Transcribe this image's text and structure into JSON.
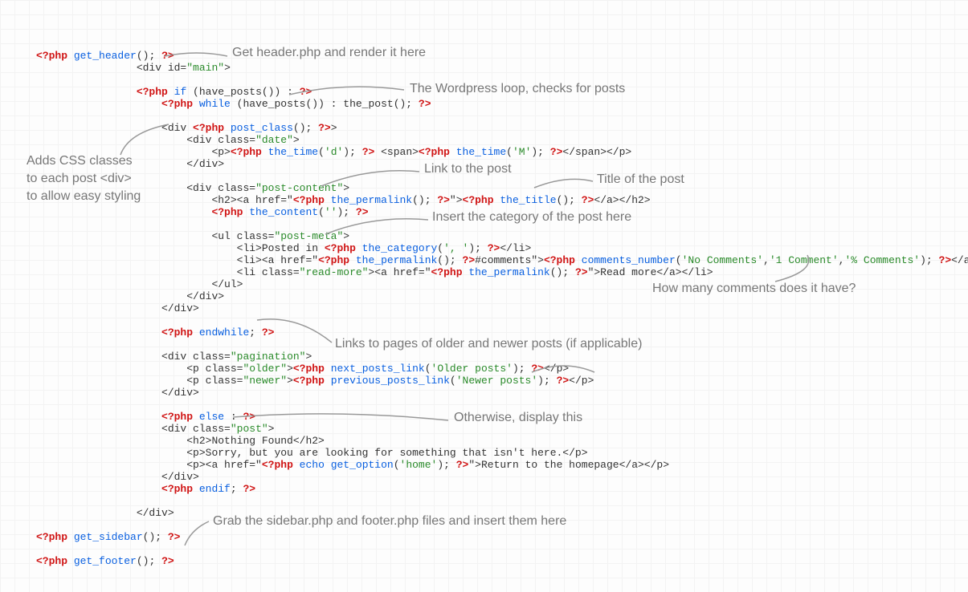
{
  "code": {
    "l1": {
      "a": "<?php",
      "b": " get_header",
      "c": "(); ",
      "d": "?>"
    },
    "l2": {
      "a": "<div id=",
      "b": "\"main\"",
      "c": ">"
    },
    "l3": {
      "a": "<?php",
      "b": " if",
      "c": " (have_posts()) : ",
      "d": "?>"
    },
    "l4": {
      "a": "<?php",
      "b": " while",
      "c": " (have_posts()) : the_post(); ",
      "d": "?>"
    },
    "l5": {
      "a": "<div ",
      "b": "<?php",
      "c": " post_class",
      "d": "(); ",
      "e": "?>",
      "f": ">"
    },
    "l6": {
      "a": "<div class=",
      "b": "\"date\"",
      "c": ">"
    },
    "l7": {
      "a": "<p>",
      "b": "<?php",
      "c": " the_time",
      "d": "(",
      "e": "'d'",
      "f": "); ",
      "g": "?>",
      "h": " <span>",
      "i": "<?php",
      "j": " the_time",
      "k": "(",
      "l": "'M'",
      "m": "); ",
      "n": "?>",
      "o": "</span></p>"
    },
    "l8": {
      "a": "</div>"
    },
    "l9": {
      "a": "<div class=",
      "b": "\"post-content\"",
      "c": ">"
    },
    "l10": {
      "a": "<h2><a href=\"",
      "b": "<?php",
      "c": " the_permalink",
      "d": "(); ",
      "e": "?>",
      "f": "\">",
      "g": "<?php",
      "h": " the_title",
      "i": "(); ",
      "j": "?>",
      "k": "</a></h2>"
    },
    "l11": {
      "a": "<?php",
      "b": " the_content",
      "c": "(",
      "d": "''",
      "e": "); ",
      "f": "?>"
    },
    "l12": {
      "a": "<ul class=",
      "b": "\"post-meta\"",
      "c": ">"
    },
    "l13": {
      "a": "<li>Posted in ",
      "b": "<?php",
      "c": " the_category",
      "d": "(",
      "e": "', '",
      "f": "); ",
      "g": "?>",
      "h": "</li>"
    },
    "l14": {
      "a": "<li><a href=\"",
      "b": "<?php",
      "c": " the_permalink",
      "d": "(); ",
      "e": "?>",
      "f": "#comments\">",
      "g": "<?php",
      "h": " comments_number",
      "i": "(",
      "j": "'No Comments'",
      "k": ",",
      "l": "'1 Comment'",
      "m": ",",
      "n": "'% Comments'",
      "o": "); ",
      "p": "?>",
      "q": "</a></li>"
    },
    "l15": {
      "a": "<li class=",
      "b": "\"read-more\"",
      "c": "><a href=\"",
      "d": "<?php",
      "e": " the_permalink",
      "f": "(); ",
      "g": "?>",
      "h": "\">Read more</a></li>"
    },
    "l16": {
      "a": "</ul>"
    },
    "l17": {
      "a": "</div>"
    },
    "l18": {
      "a": "</div>"
    },
    "l19": {
      "a": "<?php",
      "b": " endwhile",
      "c": "; ",
      "d": "?>"
    },
    "l20": {
      "a": "<div class=",
      "b": "\"pagination\"",
      "c": ">"
    },
    "l21": {
      "a": "<p class=",
      "b": "\"older\"",
      "c": ">",
      "d": "<?php",
      "e": " next_posts_link",
      "f": "(",
      "g": "'Older posts'",
      "h": "); ",
      "i": "?>",
      "j": "</p>"
    },
    "l22": {
      "a": "<p class=",
      "b": "\"newer\"",
      "c": ">",
      "d": "<?php",
      "e": " previous_posts_link",
      "f": "(",
      "g": "'Newer posts'",
      "h": "); ",
      "i": "?>",
      "j": "</p>"
    },
    "l23": {
      "a": "</div>"
    },
    "l24": {
      "a": "<?php",
      "b": " else",
      "c": " : ",
      "d": "?>"
    },
    "l25": {
      "a": "<div class=",
      "b": "\"post\"",
      "c": ">"
    },
    "l26": {
      "a": "<h2>Nothing Found</h2>"
    },
    "l27": {
      "a": "<p>Sorry, but you are looking for something that isn't here.</p>"
    },
    "l28": {
      "a": "<p><a href=\"",
      "b": "<?php",
      "c": " echo",
      "d": " get_option",
      "e": "(",
      "f": "'home'",
      "g": "); ",
      "h": "?>",
      "i": "\">Return to the homepage</a></p>"
    },
    "l29": {
      "a": "</div>"
    },
    "l30": {
      "a": "<?php",
      "b": " endif",
      "c": "; ",
      "d": "?>"
    },
    "l31": {
      "a": "</div>"
    },
    "l32": {
      "a": "<?php",
      "b": " get_sidebar",
      "c": "(); ",
      "d": "?>"
    },
    "l33": {
      "a": "<?php",
      "b": " get_footer",
      "c": "(); ",
      "d": "?>"
    }
  },
  "notes": {
    "n1": "Get header.php and render it here",
    "n2": "The Wordpress loop, checks for posts",
    "n3": "Adds CSS classes\nto each post <div>\nto allow easy styling",
    "n4": "Link to the post",
    "n5": "Title of the post",
    "n6": "Insert the category of the post here",
    "n7": "How many comments does it have?",
    "n8": "Links to pages of older and newer posts (if applicable)",
    "n9": "Otherwise, display this",
    "n10": "Grab the sidebar.php and footer.php files and insert them here"
  }
}
